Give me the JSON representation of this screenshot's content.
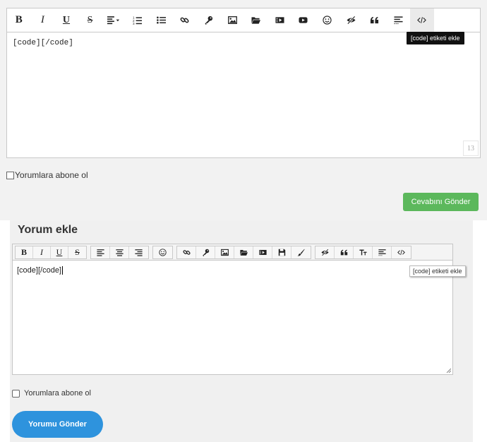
{
  "panel1": {
    "toolbar": [
      {
        "name": "bold-button",
        "label": "B"
      },
      {
        "name": "italic-button",
        "label": "I"
      },
      {
        "name": "underline-button",
        "label": "U"
      },
      {
        "name": "strikethrough-button",
        "label": "S"
      },
      {
        "name": "align-dropdown-button",
        "icon": "align-left-dropdown-icon"
      },
      {
        "name": "ordered-list-button",
        "icon": "ordered-list-icon"
      },
      {
        "name": "bullet-list-button",
        "icon": "bullet-list-icon"
      },
      {
        "name": "link-button",
        "icon": "link-icon"
      },
      {
        "name": "key-button",
        "icon": "key-icon"
      },
      {
        "name": "image-button",
        "icon": "image-icon"
      },
      {
        "name": "folder-button",
        "icon": "folder-icon"
      },
      {
        "name": "video-button",
        "icon": "video-icon"
      },
      {
        "name": "youtube-button",
        "icon": "youtube-icon"
      },
      {
        "name": "emoji-button",
        "icon": "smile-icon"
      },
      {
        "name": "spoiler-button",
        "icon": "eye-slash-icon"
      },
      {
        "name": "quote-button",
        "icon": "quote-icon"
      },
      {
        "name": "paragraph-button",
        "icon": "text-lines-icon"
      },
      {
        "name": "code-button",
        "icon": "code-icon"
      }
    ],
    "editor_text": "[code][/code]",
    "char_counter": "13",
    "tooltip": "[code] etiketi ekle",
    "subscribe_label": "Yorumlara abone ol",
    "submit_label": "Cevabını Gönder",
    "submit_color": "#5cb85c"
  },
  "panel2": {
    "title": "Yorum ekle",
    "toolbar_groups": [
      [
        {
          "name": "bold-button",
          "label": "B"
        },
        {
          "name": "italic-button",
          "label": "I"
        },
        {
          "name": "underline-button",
          "label": "U"
        },
        {
          "name": "strikethrough-button",
          "label": "S"
        }
      ],
      [
        {
          "name": "align-left-button",
          "icon": "align-left-icon"
        },
        {
          "name": "align-center-button",
          "icon": "align-center-icon"
        },
        {
          "name": "align-right-button",
          "icon": "align-right-icon"
        }
      ],
      [
        {
          "name": "emoji-button",
          "icon": "smile-icon"
        }
      ],
      [
        {
          "name": "link-button",
          "icon": "link-icon"
        },
        {
          "name": "key-button",
          "icon": "key-icon"
        },
        {
          "name": "image-button",
          "icon": "image-icon"
        },
        {
          "name": "folder-button",
          "icon": "folder-icon"
        },
        {
          "name": "video-button",
          "icon": "video-icon"
        },
        {
          "name": "save-button",
          "icon": "floppy-icon"
        },
        {
          "name": "brush-button",
          "icon": "brush-icon"
        }
      ],
      [
        {
          "name": "spoiler-button",
          "icon": "eye-slash-icon"
        },
        {
          "name": "quote-button",
          "icon": "quote-icon"
        },
        {
          "name": "text-size-button",
          "icon": "text-height-icon"
        },
        {
          "name": "paragraph-button",
          "icon": "text-lines-icon"
        },
        {
          "name": "code-button",
          "icon": "code-icon"
        }
      ]
    ],
    "editor_text": "[code][/code]",
    "tooltip": "[code] etiketi ekle",
    "subscribe_label": "Yorumlara abone ol",
    "submit_label": "Yorumu Gönder",
    "submit_color": "#2e93dd"
  }
}
